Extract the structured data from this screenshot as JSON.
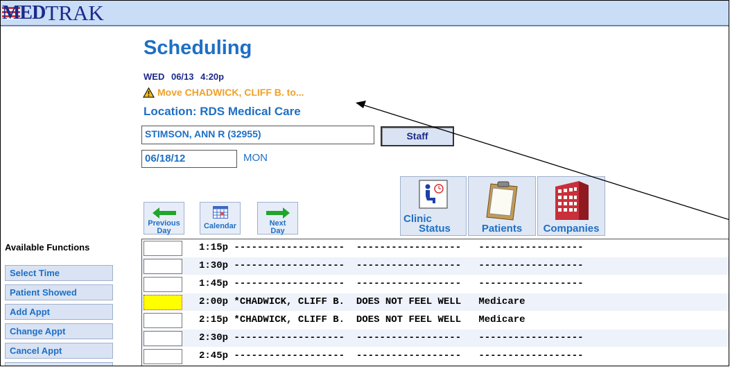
{
  "app": {
    "logo_text": "MEDTRAK",
    "logo_prefix": "MED",
    "logo_suffix": "TRAK"
  },
  "header": {
    "title": "Scheduling",
    "day": "WED",
    "date": "06/13",
    "time": "4:20p",
    "warning": "Move CHADWICK, CLIFF B. to...",
    "location": "Location: RDS Medical Care"
  },
  "form": {
    "staff_value": "STIMSON, ANN R (32955)",
    "staff_button": "Staff",
    "date_value": "06/18/12",
    "day_of_week": "MON"
  },
  "nav": {
    "previous": [
      "Previous",
      "Day"
    ],
    "calendar": "Calendar",
    "next": [
      "Next",
      "Day"
    ]
  },
  "big_buttons": {
    "clinic": [
      "Clinic",
      "Status"
    ],
    "patients": "Patients",
    "companies": "Companies"
  },
  "functions": {
    "title": "Available Functions",
    "items": [
      "Select Time",
      "Patient Showed",
      "Add Appt",
      "Change Appt",
      "Cancel Appt"
    ]
  },
  "schedule": {
    "rows": [
      {
        "time": "1:15p",
        "name": "-------------------",
        "reason": "------------------",
        "payer": "------------------",
        "selected": false
      },
      {
        "time": "1:30p",
        "name": "-------------------",
        "reason": "------------------",
        "payer": "------------------",
        "selected": false
      },
      {
        "time": "1:45p",
        "name": "-------------------",
        "reason": "------------------",
        "payer": "------------------",
        "selected": false
      },
      {
        "time": "2:00p",
        "name": "*CHADWICK, CLIFF B.",
        "reason": "DOES NOT FEEL WELL",
        "payer": "Medicare",
        "selected": true
      },
      {
        "time": "2:15p",
        "name": "*CHADWICK, CLIFF B.",
        "reason": "DOES NOT FEEL WELL",
        "payer": "Medicare",
        "selected": false
      },
      {
        "time": "2:30p",
        "name": "-------------------",
        "reason": "------------------",
        "payer": "------------------",
        "selected": false
      },
      {
        "time": "2:45p",
        "name": "-------------------",
        "reason": "------------------",
        "payer": "------------------",
        "selected": false
      }
    ]
  },
  "colors": {
    "accent": "#1e6fc4",
    "warning": "#f0a028",
    "selected_cell": "#ffff00",
    "topbar": "#c9ddf6"
  }
}
